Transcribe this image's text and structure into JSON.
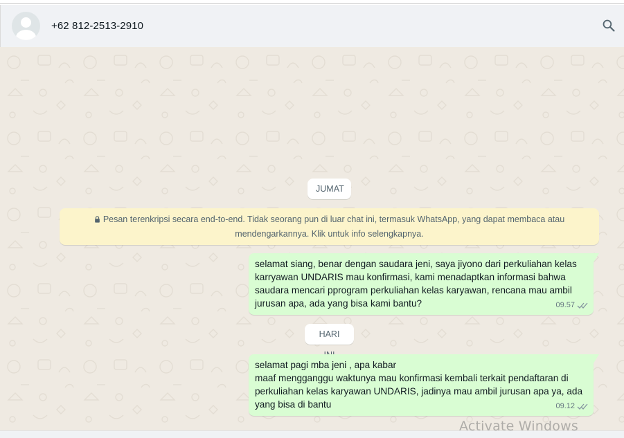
{
  "header": {
    "contact_name": "+62 812-2513-2910",
    "avatar_icon": "default-avatar-icon",
    "search_icon": "search-icon"
  },
  "chat": {
    "background_color": "#efeae2",
    "date_chips": [
      {
        "label": "JUMAT"
      },
      {
        "label": "HARI INI"
      }
    ],
    "encryption_notice": {
      "line1": "Pesan terenkripsi secara end-to-end. Tidak seorang pun di luar chat ini, termasuk WhatsApp, yang dapat membaca atau",
      "line2": "mendengarkannya. Klik untuk info selengkapnya."
    },
    "messages": [
      {
        "direction": "outgoing",
        "lines": [
          "selamat siang, benar dengan saudara jeni, saya jiyono dari perkuliahan kelas",
          "karryawan UNDARIS mau konfirmasi, kami menadaptkan informasi bahwa",
          "saudara mencari pprogram perkuliahan kelas karyawan, rencana mau ambil",
          "jurusan apa, ada yang bisa kami bantu?"
        ],
        "time": "09.57",
        "status": "read"
      },
      {
        "direction": "outgoing",
        "lines": [
          "selamat pagi mba jeni , apa kabar",
          "maaf mengganggu waktunya mau konfirmasi kembali terkait pendaftaran di",
          "perkuliahan kelas karyawan UNDARIS, jadinya mau ambil jurusan apa ya, ada",
          "yang bisa di bantu"
        ],
        "time": "09.12",
        "status": "read"
      }
    ],
    "outgoing_bubble_color": "#d9fdd3",
    "notice_color": "#fcf4cb"
  },
  "overlay": {
    "watermark": "Activate Windows"
  }
}
